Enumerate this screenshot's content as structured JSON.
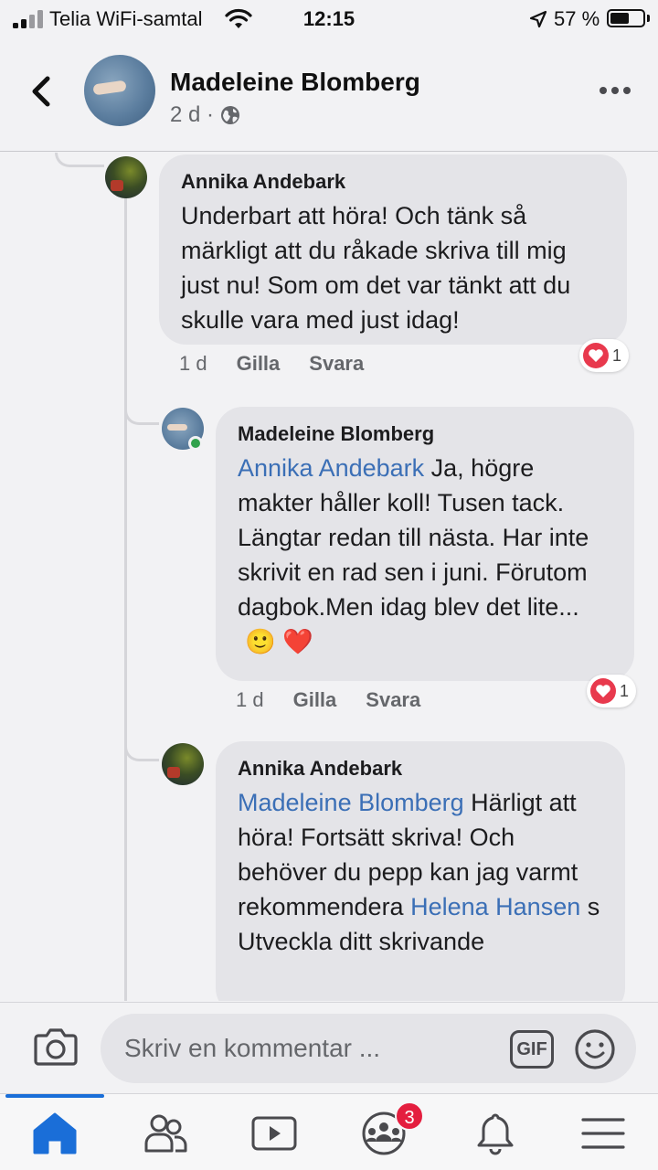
{
  "status_bar": {
    "carrier": "Telia WiFi-samtal",
    "time": "12:15",
    "battery": "57 %"
  },
  "header": {
    "name": "Madeleine Blomberg",
    "meta": "2 d ·",
    "back_icon": "chevron-left-icon",
    "more_icon": "more-horizontal-icon"
  },
  "comments": [
    {
      "author": "Annika Andebark",
      "mention": "",
      "text": "Underbart att höra! Och tänk så märkligt att du råkade skriva till mig just nu! Som om det var tänkt att du skulle vara med just idag!",
      "time": "1 d",
      "like": "Gilla",
      "reply": "Svara",
      "reaction_count": "1"
    },
    {
      "author": "Madeleine Blomberg",
      "mention": "Annika Andebark",
      "text": " Ja, högre makter håller koll! Tusen tack. Längtar redan till nästa. Har inte skrivit en rad sen i juni. Förutom dagbok.Men idag blev det lite...",
      "emoji": "🙂 ❤️",
      "time": "1 d",
      "like": "Gilla",
      "reply": "Svara",
      "reaction_count": "1"
    },
    {
      "author": "Annika Andebark",
      "mention": "Madeleine Blomberg",
      "text_a": " Härligt att höra! Fortsätt skriva! Och behöver du pepp kan jag varmt rekommendera ",
      "mention2": "Helena Hansen",
      "text_b": " s Utveckla ditt skrivande"
    }
  ],
  "composer": {
    "placeholder": "Skriv en kommentar ...",
    "gif": "GIF"
  },
  "tabbar": {
    "groups_badge": "3",
    "tabs": [
      "home-icon",
      "friends-icon",
      "watch-icon",
      "groups-icon",
      "notifications-icon",
      "menu-icon"
    ]
  },
  "colors": {
    "mention": "#3b6fb6",
    "accent": "#1a6ed8",
    "badge": "#e41e3f",
    "heart": "#e8394d"
  }
}
